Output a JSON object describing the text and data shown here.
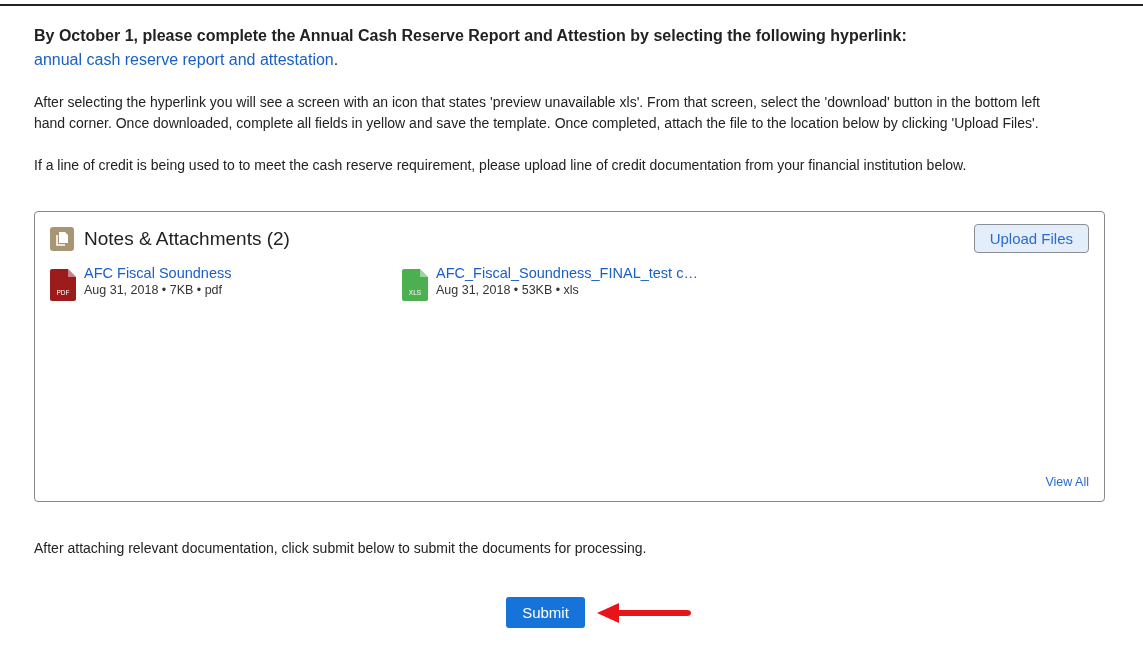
{
  "instructions": {
    "heading": "By October 1, please complete the Annual Cash Reserve Report and Attestion by selecting the following hyperlink:",
    "link": "annual cash reserve report and attestation",
    "heading_end": ".",
    "paragraphs": [
      "After selecting the hyperlink you will see a screen with an icon that states 'preview unavailable xls'. From that screen, select the 'download' button in the bottom left hand corner. Once downloaded, complete all fields in yellow and save the template. Once completed, attach the file to the location below by clicking 'Upload Files'.",
      "If a line of credit is being used to to meet the cash reserve requirement, please upload line of credit documentation from your financial institution below."
    ]
  },
  "attachments": {
    "title": "Notes & Attachments",
    "count": "(2)",
    "upload_button": "Upload Files",
    "files": [
      {
        "kind": "pdf",
        "name": "AFC Fiscal Soundness",
        "icon_label": "PDF",
        "meta": "Aug 31, 2018 • 7KB • pdf"
      },
      {
        "kind": "xls",
        "name": "AFC_Fiscal_Soundness_FINAL_test c…",
        "icon_label": "XLS",
        "meta": "Aug 31, 2018 • 53KB • xls"
      }
    ],
    "view_all": "View All"
  },
  "footer_text": "After attaching relevant documentation, click submit below to submit the documents for processing.",
  "submit_button": "Submit"
}
